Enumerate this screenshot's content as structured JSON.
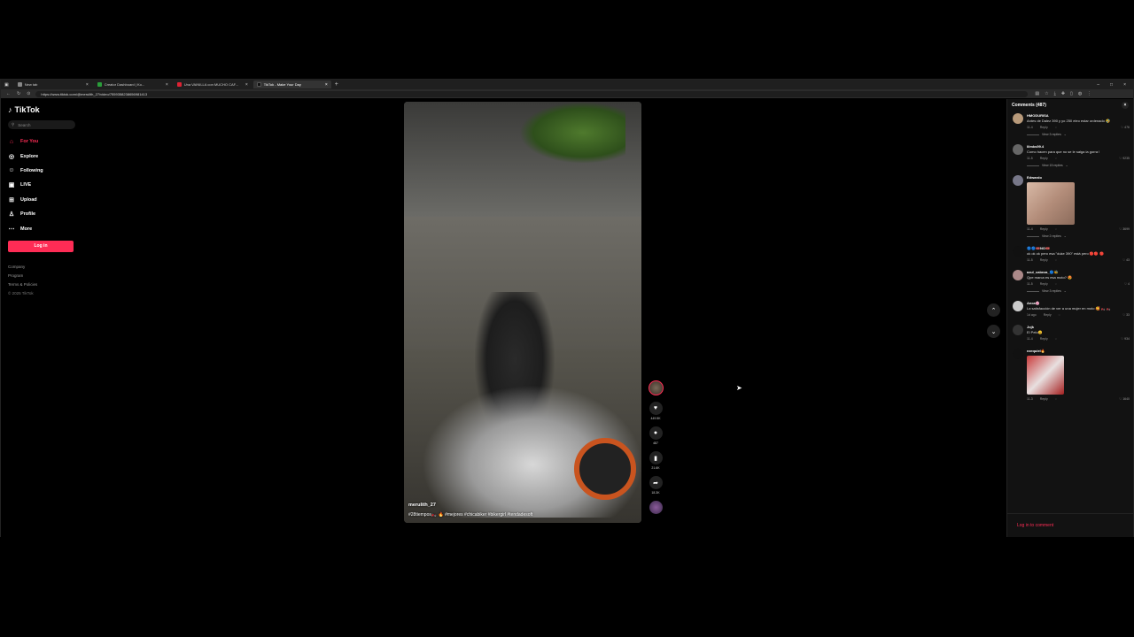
{
  "browser": {
    "tabs": [
      {
        "title": "New tab",
        "fav": "#888"
      },
      {
        "title": "Creator Dashboard | Ko...",
        "fav": "#2a9d3a"
      },
      {
        "title": "Una VAINILLA con MUCHO CAF...",
        "fav": "#d23"
      },
      {
        "title": "TikTok - Make Your Day",
        "fav": "#111",
        "active": true
      }
    ],
    "url": "https://www.tiktok.com/@merulith_27/video/7559358238656981413"
  },
  "sidebar": {
    "logo": "TikTok",
    "search_placeholder": "Search",
    "nav": [
      {
        "label": "For You",
        "icon": "home-icon",
        "glyph": "⌂",
        "active": true
      },
      {
        "label": "Explore",
        "icon": "compass-icon",
        "glyph": "◎"
      },
      {
        "label": "Following",
        "icon": "people-icon",
        "glyph": "☺"
      },
      {
        "label": "LIVE",
        "icon": "live-icon",
        "glyph": "▣"
      },
      {
        "label": "Upload",
        "icon": "upload-icon",
        "glyph": "⊞"
      },
      {
        "label": "Profile",
        "icon": "profile-icon",
        "glyph": "♙"
      },
      {
        "label": "More",
        "icon": "more-icon",
        "glyph": "⋯"
      }
    ],
    "login_label": "Log in",
    "footer": [
      "Company",
      "Program",
      "Terms & Policies"
    ],
    "copyright": "© 2025 TikTok"
  },
  "video": {
    "username": "merulith_27",
    "caption": "#28tiempos🏍️ 🔥 #mejores #chicabiker #bikergirl #tendadesoft",
    "likes": "449.5K",
    "comments": "487",
    "saves": "21.6K",
    "shares": "18.3K"
  },
  "comments": {
    "title": "Comments (487)",
    "login_prompt": "Log in to comment",
    "items": [
      {
        "name": "HMODURISA",
        "text": "Antes de Dalez 390 y yo 250 eleo estar ordenado 🤣",
        "date": "11-4",
        "likes": "476",
        "replies": "View 3 replies",
        "av": "#b89a7a"
      },
      {
        "name": "lilmks99.4",
        "text": "Como hacen para que no se le salga la gorra !",
        "date": "11-5",
        "likes": "9235",
        "replies": "View 15 replies",
        "av": "#666"
      },
      {
        "name": "Edwardo",
        "text": "",
        "date": "11-4",
        "likes": "3699",
        "replies": "View 2 replies",
        "av": "#778",
        "sticker": true
      },
      {
        "name": "🔵🔵🎟️NO🎟️",
        "text": "ok ok ok pero esa \"duke 390\" está pero 🔴🔴 🔴",
        "date": "11-5",
        "likes": "43",
        "replies": "",
        "av": "#111"
      },
      {
        "name": "azul_cabeza_🔵🐝",
        "text": "Qpe marca es esa moto? 😍",
        "date": "11-5",
        "likes": "4",
        "replies": "View 3 replies",
        "av": "#a88"
      },
      {
        "name": "Anca🌸",
        "text": "La satisfacción de ver a una mujer en moto 🥰 🏍️ 🏍️",
        "date": "1d ago",
        "likes": "33",
        "replies": "",
        "av": "#ccc"
      },
      {
        "name": "Jojk",
        "text": "El Pelo😊",
        "date": "11-4",
        "likes": "934",
        "replies": "",
        "av": "#333"
      },
      {
        "name": "ezequiel🔥",
        "text": "",
        "date": "11-3",
        "likes": "1640",
        "replies": "",
        "av": "#111",
        "sticker2": true
      }
    ],
    "reply_label": "Reply"
  }
}
